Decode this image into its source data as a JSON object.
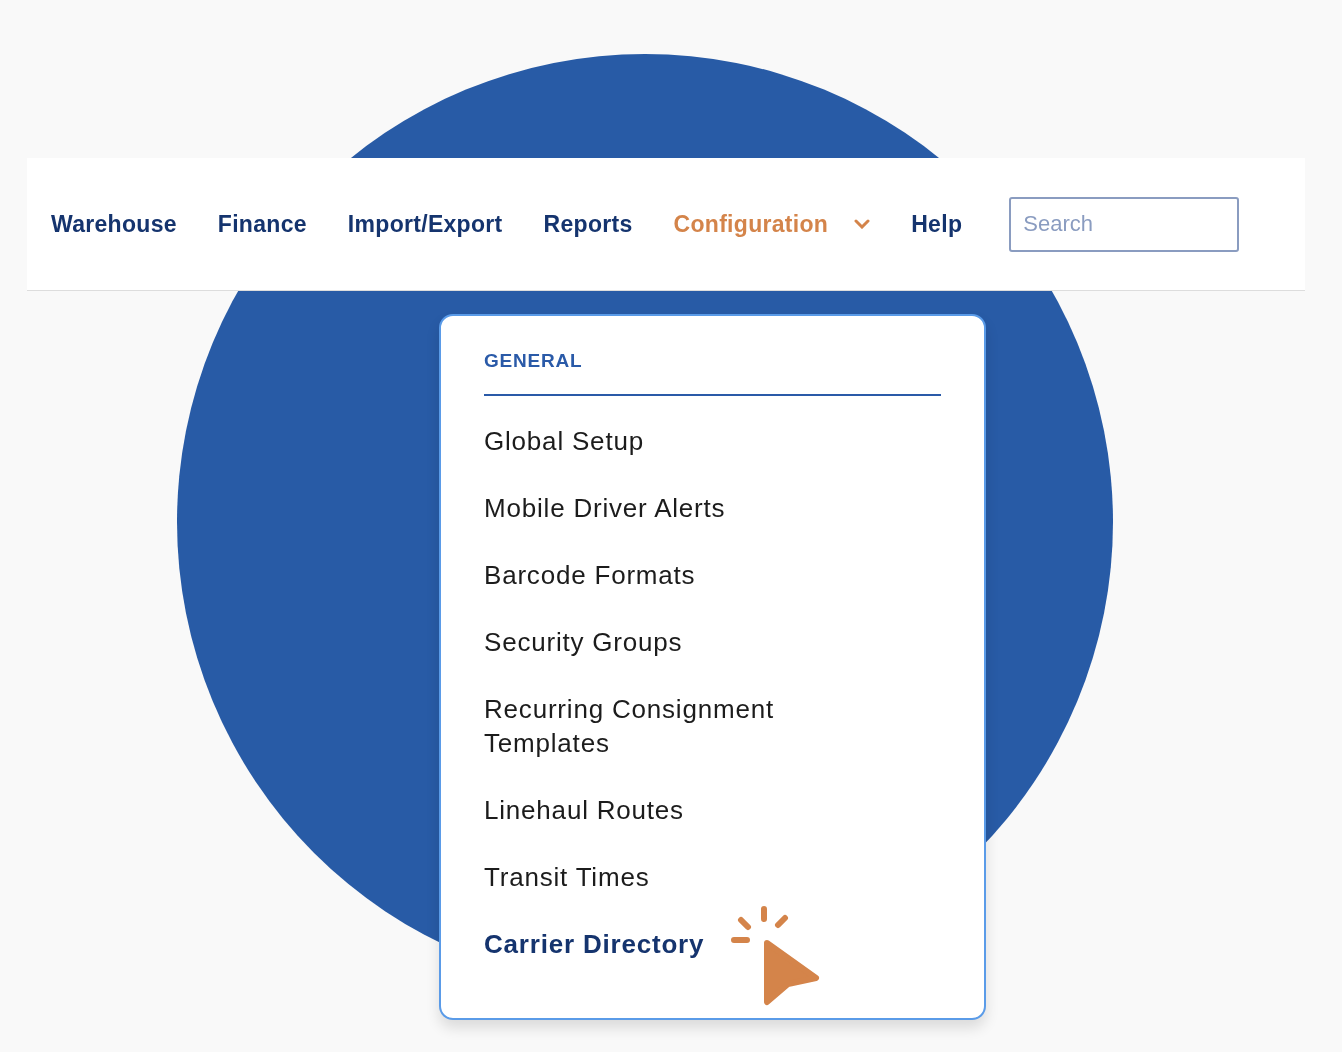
{
  "nav": {
    "items": [
      {
        "label": "Warehouse",
        "selected": false,
        "dropdown": false
      },
      {
        "label": "Finance",
        "selected": false,
        "dropdown": false
      },
      {
        "label": "Import/Export",
        "selected": false,
        "dropdown": false
      },
      {
        "label": "Reports",
        "selected": false,
        "dropdown": false
      },
      {
        "label": "Configuration",
        "selected": true,
        "dropdown": true
      },
      {
        "label": "Help",
        "selected": false,
        "dropdown": false
      }
    ],
    "search": {
      "placeholder": "Search"
    }
  },
  "menu": {
    "section": "GENERAL",
    "items": [
      {
        "label": "Global Setup",
        "selected": false
      },
      {
        "label": "Mobile Driver Alerts",
        "selected": false
      },
      {
        "label": "Barcode Formats",
        "selected": false
      },
      {
        "label": "Security Groups",
        "selected": false
      },
      {
        "label": "Recurring Consignment Templates",
        "selected": false
      },
      {
        "label": "Linehaul Routes",
        "selected": false
      },
      {
        "label": "Transit Times",
        "selected": false
      },
      {
        "label": "Carrier Directory",
        "selected": true
      }
    ]
  }
}
